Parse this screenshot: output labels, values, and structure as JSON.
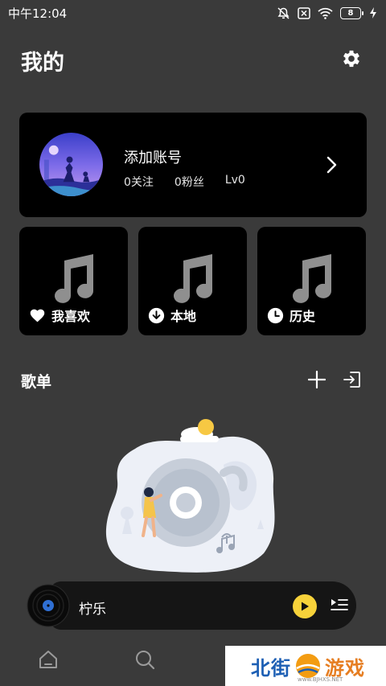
{
  "status_bar": {
    "time": "中午12:04",
    "battery": "8"
  },
  "header": {
    "title": "我的"
  },
  "profile": {
    "name": "添加账号",
    "follows": "0关注",
    "fans": "0粉丝",
    "level": "Lv0"
  },
  "tiles": [
    {
      "label": "我喜欢",
      "icon": "heart-icon"
    },
    {
      "label": "本地",
      "icon": "download-icon"
    },
    {
      "label": "历史",
      "icon": "clock-icon"
    }
  ],
  "playlist_section": {
    "title": "歌单"
  },
  "player": {
    "song": "柠乐"
  },
  "watermark": {
    "text_a": "北街",
    "text_b": "游戏",
    "site": "www.BJHXS.NET"
  },
  "colors": {
    "background": "#3a3a3a",
    "card": "#000000",
    "accent": "#f7d23a"
  }
}
